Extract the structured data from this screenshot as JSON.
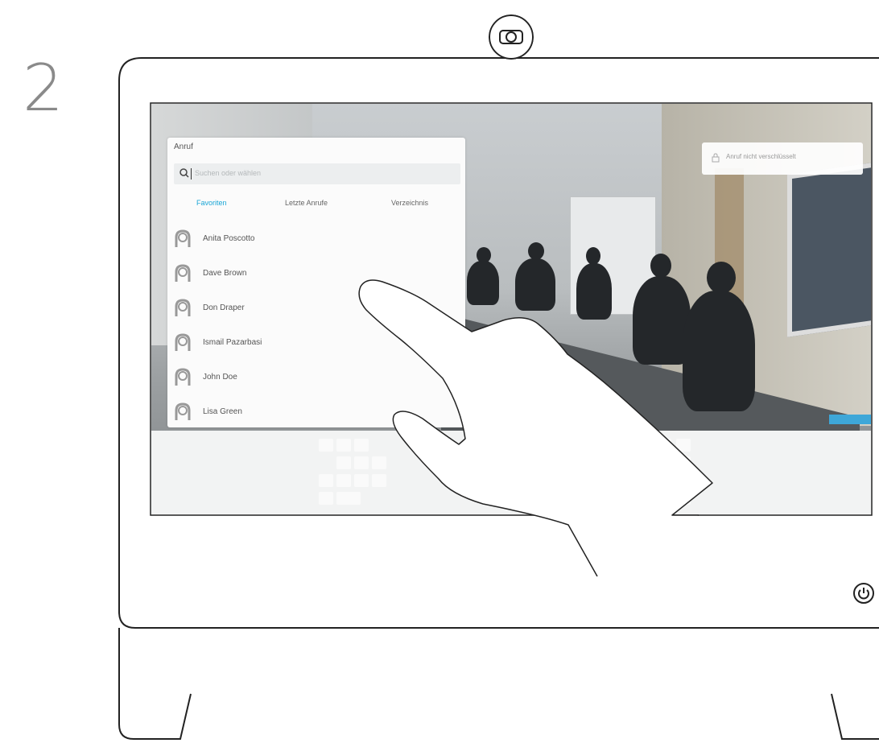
{
  "step_number": "2",
  "call_panel": {
    "title": "Anruf",
    "search_placeholder": "Suchen oder wählen",
    "tabs": [
      {
        "label": "Favoriten",
        "active": true
      },
      {
        "label": "Letzte Anrufe",
        "active": false
      },
      {
        "label": "Verzeichnis",
        "active": false
      }
    ],
    "contacts": [
      {
        "name": "Anita Poscotto"
      },
      {
        "name": "Dave Brown"
      },
      {
        "name": "Don Draper"
      },
      {
        "name": "Ismail Pazarbasi"
      },
      {
        "name": "John Doe"
      },
      {
        "name": "Lisa Green"
      }
    ]
  },
  "encryption_notice": "Anruf nicht verschlüsselt",
  "colors": {
    "accent": "#1aa6d6",
    "device_outline": "#222222",
    "step_number": "#8a8a8a"
  },
  "icons": {
    "camera": "camera-icon",
    "power": "power-icon",
    "search": "search-icon",
    "lock": "lock-icon",
    "contact": "person-icon"
  }
}
